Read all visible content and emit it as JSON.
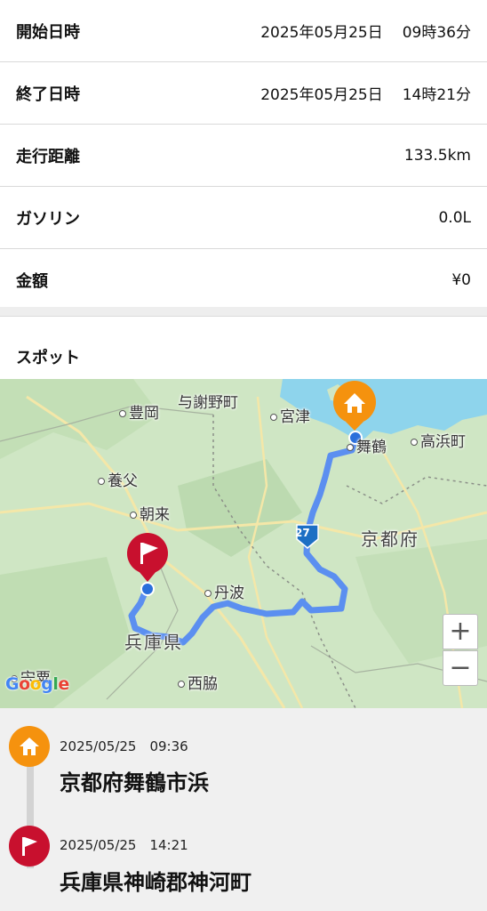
{
  "summary": {
    "start": {
      "label": "開始日時",
      "date": "2025年05月25日",
      "time": "09時36分"
    },
    "end": {
      "label": "終了日時",
      "date": "2025年05月25日",
      "time": "14時21分"
    },
    "distance": {
      "label": "走行距離",
      "value": "133.5km"
    },
    "gasoline": {
      "label": "ガソリン",
      "value": "0.0L"
    },
    "amount": {
      "label": "金額",
      "value": "¥0"
    }
  },
  "spot_title": "スポット",
  "map": {
    "places": {
      "toyooka": "豊岡",
      "yosano": "与謝野町",
      "miyazu": "宮津",
      "maizuru": "舞鶴",
      "takahama": "高浜町",
      "yabu": "養父",
      "asago": "朝来",
      "kyoto_pref": "京都府",
      "tamba": "丹波",
      "hyogo_pref": "兵庫県",
      "nishiwaki": "西脇",
      "shiso": "宍粟"
    },
    "route_shield": "27",
    "zoom_in": "+",
    "zoom_out": "−",
    "attribution": "Google",
    "route_color": "#5b8ff0"
  },
  "timeline": [
    {
      "icon": "home-icon",
      "color": "#f5920e",
      "time": "2025/05/25　09:36",
      "place": "京都府舞鶴市浜"
    },
    {
      "icon": "flag-icon",
      "color": "#c8102e",
      "time": "2025/05/25　14:21",
      "place": "兵庫県神崎郡神河町"
    }
  ]
}
